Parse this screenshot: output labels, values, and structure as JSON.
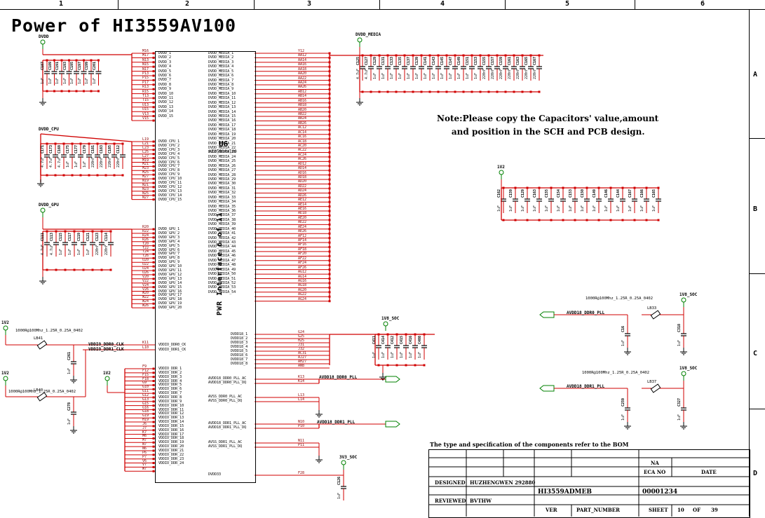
{
  "frame": {
    "columns": [
      "1",
      "2",
      "3",
      "4",
      "5",
      "6"
    ],
    "rows": [
      "A",
      "B",
      "C",
      "D"
    ]
  },
  "title": "Power of HI3559AV100",
  "note": [
    "Note:Please copy the Capacitors' value,amount",
    "and position in the SCH and PCB design."
  ],
  "ic": {
    "ref": "U6",
    "part": "HI3559AV100",
    "interface": "PWR Interface 6 of 11"
  },
  "nets": {
    "dvdd": "DVDD",
    "dvdd_media": "DVDD_MEDIA",
    "dvdd_cpu": "DVDD_CPU",
    "dvdd_gpu": "DVDD_GPU",
    "v1v2": "1V2",
    "v1v8_soc": "1V8_SOC",
    "v3v3_soc": "3V3_SOC",
    "vddio_ddr0_ck": "VDDIO_DDR0_CLK",
    "vddio_ddr1_ck": "VDDIO_DDR1_CLK",
    "avdd18_ddr0_pll": "AVDD18_DDR0_PLL",
    "avdd18_ddr1_pll": "AVDD18_DDR1_PLL"
  },
  "pins_left": {
    "dvdd": [
      "M16",
      "M17",
      "N13",
      "N15",
      "N17",
      "P13",
      "P15",
      "P17",
      "R13",
      "R15",
      "T13",
      "T15",
      "U13",
      "U15",
      "V13",
      "V15"
    ],
    "dvdd_names": [
      "DVDD_1",
      "DVDD_2",
      "DVDD_3",
      "DVDD_4",
      "DVDD_5",
      "DVDD_6",
      "DVDD_7",
      "DVDD_8",
      "DVDD_9",
      "DVDD_10",
      "DVDD_11",
      "DVDD_12",
      "DVDD_13",
      "DVDD_14",
      "DVDD_15"
    ],
    "cpu": [
      "L19",
      "L21",
      "L23",
      "L25",
      "L27",
      "M19",
      "M21",
      "M23",
      "M25",
      "M27",
      "N19",
      "N21",
      "N23",
      "N25",
      "N27"
    ],
    "cpu_names": [
      "DVDD_CPU_1",
      "DVDD_CPU_2",
      "DVDD_CPU_3",
      "DVDD_CPU_4",
      "DVDD_CPU_5",
      "DVDD_CPU_6",
      "DVDD_CPU_7",
      "DVDD_CPU_8",
      "DVDD_CPU_9",
      "DVDD_CPU_10",
      "DVDD_CPU_11",
      "DVDD_CPU_12",
      "DVDD_CPU_13",
      "DVDD_CPU_14",
      "DVDD_CPU_15"
    ],
    "gpu": [
      "R20",
      "R22",
      "R24",
      "R26",
      "T20",
      "T22",
      "T24",
      "T26",
      "U20",
      "U22",
      "U24",
      "U26",
      "V20",
      "V22",
      "V24",
      "V26",
      "W20",
      "W22",
      "W24",
      "W26"
    ],
    "gpu_names": [
      "DVDD_GPU_1",
      "DVDD_GPU_2",
      "DVDD_GPU_3",
      "DVDD_GPU_4",
      "DVDD_GPU_5",
      "DVDD_GPU_6",
      "DVDD_GPU_7",
      "DVDD_GPU_8",
      "DVDD_GPU_9",
      "DVDD_GPU_10",
      "DVDD_GPU_11",
      "DVDD_GPU_12",
      "DVDD_GPU_13",
      "DVDD_GPU_14",
      "DVDD_GPU_15",
      "DVDD_GPU_16",
      "DVDD_GPU_17",
      "DVDD_GPU_18",
      "DVDD_GPU_19",
      "DVDD_GPU_20"
    ],
    "ck": [
      "K11",
      "L10"
    ],
    "ck_names": [
      "VDDIO_DDR0_CK",
      "VDDIO_DDR1_CK"
    ],
    "ddr": [
      "F9",
      "F12",
      "F15",
      "F18",
      "G9",
      "G10",
      "G11",
      "G12",
      "G13",
      "G15",
      "G16",
      "G18",
      "G19",
      "H19",
      "J6",
      "J7",
      "K7",
      "M6",
      "M7",
      "N7",
      "N6",
      "P6",
      "P7",
      "V6",
      "V7",
      "W7"
    ],
    "ddr_names": [
      "VDDIO_DDR_1",
      "VDDIO_DDR_2",
      "VDDIO_DDR_3",
      "VDDIO_DDR_4",
      "VDDIO_DDR_5",
      "VDDIO_DDR_6",
      "VDDIO_DDR_7",
      "VDDIO_DDR_8",
      "VDDIO_DDR_9",
      "VDDIO_DDR_10",
      "VDDIO_DDR_11",
      "VDDIO_DDR_12",
      "VDDIO_DDR_13",
      "VDDIO_DDR_14",
      "VDDIO_DDR_15",
      "VDDIO_DDR_16",
      "VDDIO_DDR_17",
      "VDDIO_DDR_18",
      "VDDIO_DDR_19",
      "VDDIO_DDR_20",
      "VDDIO_DDR_21",
      "VDDIO_DDR_22",
      "VDDIO_DDR_23",
      "VDDIO_DDR_24"
    ]
  },
  "pins_right": {
    "media": [
      "Y12",
      "AA12",
      "AA14",
      "AA16",
      "AA18",
      "AA20",
      "AA22",
      "AA24",
      "AA26",
      "AB12",
      "AB14",
      "AB16",
      "AB18",
      "AB20",
      "AB22",
      "AB24",
      "AB26",
      "AC12",
      "AC14",
      "AC16",
      "AC18",
      "AC20",
      "AC22",
      "AC24",
      "AC26",
      "AD12",
      "AD14",
      "AD16",
      "AD18",
      "AD20",
      "AD22",
      "AD24",
      "AD26",
      "AE12",
      "AE14",
      "AE16",
      "AE18",
      "AE20",
      "AE22",
      "AE24",
      "AE26",
      "AF12",
      "AF14",
      "AF16",
      "AF18",
      "AF20",
      "AF22",
      "AF24",
      "AF26",
      "AG12",
      "AG14",
      "AG16",
      "AG18",
      "AG20",
      "AG22",
      "AG24"
    ],
    "media_names": [
      "DVDD_MEDIA_1",
      "DVDD_MEDIA_2",
      "DVDD_MEDIA_3",
      "DVDD_MEDIA_4",
      "DVDD_MEDIA_5",
      "DVDD_MEDIA_6",
      "DVDD_MEDIA_7",
      "DVDD_MEDIA_8",
      "DVDD_MEDIA_9",
      "DVDD_MEDIA_10",
      "DVDD_MEDIA_11",
      "DVDD_MEDIA_12",
      "DVDD_MEDIA_13",
      "DVDD_MEDIA_14",
      "DVDD_MEDIA_15",
      "DVDD_MEDIA_16",
      "DVDD_MEDIA_17",
      "DVDD_MEDIA_18",
      "DVDD_MEDIA_19",
      "DVDD_MEDIA_20",
      "DVDD_MEDIA_21",
      "DVDD_MEDIA_22",
      "DVDD_MEDIA_23",
      "DVDD_MEDIA_24",
      "DVDD_MEDIA_25",
      "DVDD_MEDIA_26",
      "DVDD_MEDIA_27",
      "DVDD_MEDIA_28",
      "DVDD_MEDIA_29",
      "DVDD_MEDIA_30",
      "DVDD_MEDIA_31",
      "DVDD_MEDIA_32",
      "DVDD_MEDIA_33",
      "DVDD_MEDIA_34",
      "DVDD_MEDIA_35",
      "DVDD_MEDIA_36",
      "DVDD_MEDIA_37",
      "DVDD_MEDIA_38",
      "DVDD_MEDIA_39",
      "DVDD_MEDIA_40",
      "DVDD_MEDIA_41",
      "DVDD_MEDIA_42",
      "DVDD_MEDIA_43",
      "DVDD_MEDIA_44",
      "DVDD_MEDIA_45",
      "DVDD_MEDIA_46",
      "DVDD_MEDIA_47",
      "DVDD_MEDIA_48",
      "DVDD_MEDIA_49",
      "DVDD_MEDIA_50",
      "DVDD_MEDIA_51",
      "DVDD_MEDIA_52",
      "DVDD_MEDIA_53",
      "DVDD_MEDIA_54"
    ],
    "dvdd18": [
      "G24",
      "G25",
      "H25",
      "J31",
      "J32",
      "AC31",
      "AJ27",
      "AH27",
      "AN8"
    ],
    "dvdd18_names": [
      "DVDD18_1",
      "DVDD18_2",
      "DVDD18_3",
      "DVDD18_4",
      "DVDD18_5",
      "DVDD18_6",
      "DVDD18_7",
      "DVDD18_8"
    ],
    "pll": [
      {
        "pin": "K13",
        "name": "AVDD18_DDR0_PLL_AC"
      },
      {
        "pin": "K14",
        "name": "AVDD18_DDR0_PLL_DQ"
      },
      {
        "pin": "L13",
        "name": "AVSS_DDR0_PLL_AC"
      },
      {
        "pin": "L14",
        "name": "AVSS_DDR0_PLL_DQ"
      },
      {
        "pin": "N10",
        "name": "AVDD18_DDR1_PLL_AC"
      },
      {
        "pin": "P10",
        "name": "AVDD18_DDR1_PLL_DQ"
      },
      {
        "pin": "N11",
        "name": "AVSS_DDR1_PLL_AC"
      },
      {
        "pin": "P11",
        "name": "AVSS_DDR1_PLL_DQ"
      },
      {
        "pin": "F28",
        "name": "DVDD33"
      }
    ]
  },
  "caps": {
    "dvdd_refs": [
      "C187",
      "C189",
      "C191",
      "C193",
      "C195",
      "C197",
      "C199",
      "C201"
    ],
    "dvdd_vals": [
      "1uF",
      "1uF",
      "1uF",
      "1uF",
      "1uF",
      "1uF",
      "1uF",
      "1uF"
    ],
    "media_refs": [
      "C125",
      "C127",
      "C129",
      "C131",
      "C133",
      "C135",
      "C137",
      "C139",
      "C141",
      "C143",
      "C145",
      "C147",
      "C149",
      "C151",
      "C153",
      "C155",
      "C157",
      "C159",
      "C161",
      "C163",
      "C165",
      "C167"
    ],
    "media_vals": [
      "4.7uF",
      "4.7uF",
      "1uF",
      "1uF",
      "1uF",
      "1uF",
      "1uF",
      "1uF",
      "1uF",
      "1uF",
      "1uF",
      "1uF",
      "1uF",
      "1uF",
      "1uF",
      "220nF",
      "220nF",
      "220nF",
      "220nF",
      "220nF",
      "220nF",
      "220nF"
    ],
    "cpu_refs": [
      "C171",
      "C173",
      "C169",
      "C175",
      "C177",
      "C179",
      "C181",
      "C183",
      "C185",
      "C112"
    ],
    "cpu_vals": [
      "4.7uF",
      "4.7uF",
      "4.7uF",
      "1uF",
      "1uF",
      "1uF",
      "220nF",
      "220nF",
      "220nF",
      "220nF"
    ],
    "gpu_refs": [
      "C111",
      "C113",
      "C115",
      "C117",
      "C119",
      "C121",
      "C123",
      "C114"
    ],
    "gpu_vals": [
      "4.7uF",
      "4.7uF",
      "1uF",
      "1uF",
      "1uF",
      "1uF",
      "220nF",
      "220nF"
    ],
    "v1v2_refs": [
      "C162",
      "C159",
      "C129",
      "C163",
      "C155",
      "C154",
      "C153",
      "C150",
      "C149",
      "C146",
      "C144",
      "C167",
      "C166",
      "C165"
    ],
    "v1v2_vals": [
      "1uF",
      "1uF",
      "1uF",
      "1uF",
      "1uF",
      "1uF",
      "1uF",
      "1uF",
      "1uF",
      "1uF",
      "1uF",
      "1uF",
      "1uF",
      "1uF"
    ],
    "soc18_refs": [
      "C411",
      "C414",
      "C412",
      "C415",
      "C416",
      "C408"
    ],
    "soc18_vals": [
      "1uF",
      "1uF",
      "1uF",
      "1uF",
      "1uF",
      "1uF"
    ],
    "single": [
      {
        "ref": "C261",
        "val": "1uF"
      },
      {
        "ref": "C278",
        "val": "1uF"
      },
      {
        "ref": "C126",
        "val": "1uF"
      },
      {
        "ref": "C16",
        "val": "1uF"
      },
      {
        "ref": "C318",
        "val": "1uF"
      },
      {
        "ref": "C259",
        "val": "1uF"
      },
      {
        "ref": "C327",
        "val": "1uF"
      }
    ]
  },
  "beads": [
    {
      "ref": "LB41",
      "spec": "1000R@100Mhz_1.25R_0.25A_0402"
    },
    {
      "ref": "LB40",
      "spec": "1000R@100Mhz_1.25R_0.25A_0402"
    },
    {
      "ref": "LB33",
      "spec": "1000R@100Mhz_1.25R_0.25A_0402"
    },
    {
      "ref": "LB37",
      "spec": "1000R@100Mhz_1.25R_0.25A_0402"
    }
  ],
  "bom_note": "The type and specification of the components  refer to the BOM",
  "titleblock": {
    "na": "NA",
    "eca_no": "ECA NO",
    "date": "DATE",
    "designed_label": "DESIGNED",
    "designed_value": "HUZHENGWEN 292880",
    "reviewed_label": "REVIEWED",
    "reviewed_value": "BVTHW",
    "board": "HI3559ADMEB",
    "number": "00001234",
    "ver": "VER",
    "part_number": "PART_NUMBER",
    "sheet": "SHEET",
    "sheet_no": "10",
    "of": "OF",
    "total": "39"
  },
  "colors": {
    "wire": "#d00000",
    "ink": "#000000",
    "pin": "#8b0000",
    "power": "#008000"
  }
}
